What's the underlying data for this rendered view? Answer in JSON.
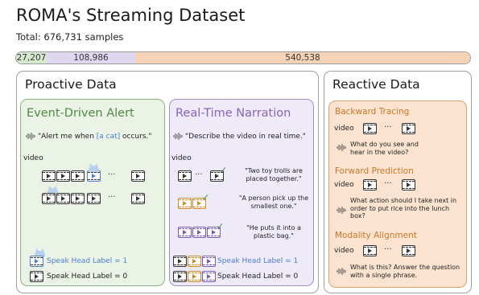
{
  "title": "ROMA's Streaming Dataset",
  "total": "Total: 676,731 samples",
  "distribution": [
    {
      "label": "27,207",
      "value": 27207,
      "color": "#d7ead0"
    },
    {
      "label": "108,986",
      "value": 108986,
      "color": "#e0d8f0"
    },
    {
      "label": "540,538",
      "value": 540538,
      "color": "#f6d3b6"
    }
  ],
  "proactive": {
    "title": "Proactive Data",
    "alert": {
      "title": "Event-Driven Alert",
      "instruction_pre": "\"Alert me when ",
      "instruction_hl": "[a cat]",
      "instruction_post": " occurs.\"",
      "video_label": "video",
      "label_1": "Speak Head Label = 1",
      "label_0": "Speak Head Label = 0"
    },
    "narration": {
      "title": "Real-Time Narration",
      "instruction": "\"Describe the video in real time.\"",
      "video_label": "video",
      "captions": [
        "\"Two toy trolls are placed together.\"",
        "\"A person pick up the smallest one.\"",
        "\"He puts it into a plastic bag.\""
      ],
      "label_1": "Speak Head Label = 1",
      "label_0": "Speak Head Label = 0"
    }
  },
  "reactive": {
    "title": "Reactive Data",
    "sections": [
      {
        "title": "Backward Tracing",
        "video_label": "video",
        "question": "What do you see and hear in the video?"
      },
      {
        "title": "Forward Prediction",
        "video_label": "video",
        "question": "What action should I take next in order to put rice into the lunch box?"
      },
      {
        "title": "Modality Alignment",
        "video_label": "video",
        "question": "What is this? Answer the question with a single phrase."
      }
    ]
  },
  "icons": [
    "waveform-icon",
    "video-frame-icon",
    "check-icon",
    "cat-icon",
    "ellipsis-icon"
  ]
}
